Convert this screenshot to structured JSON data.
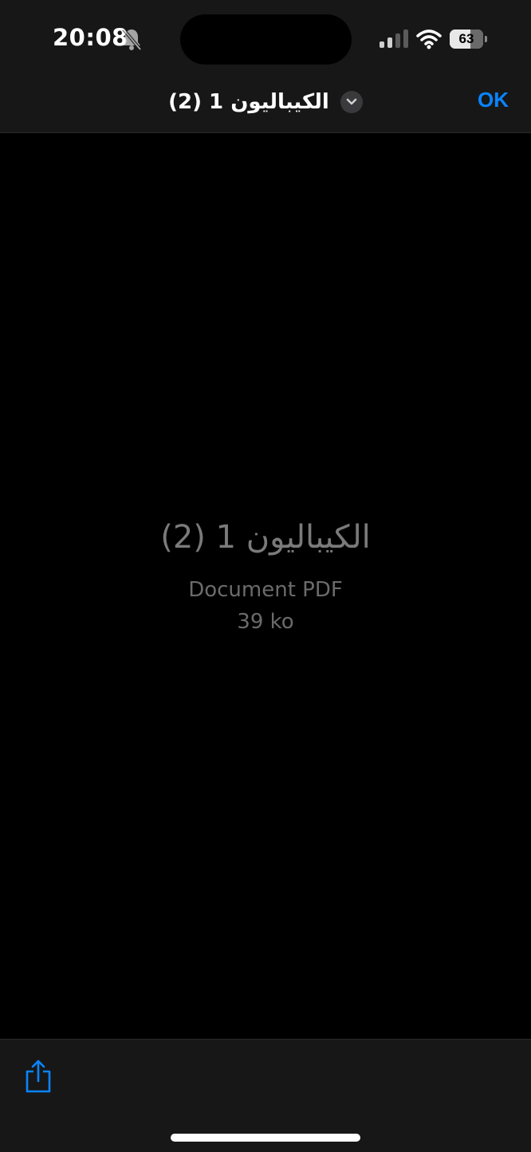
{
  "status_bar": {
    "time": "20:08",
    "battery_level": "63",
    "battery_fraction": 0.63
  },
  "nav": {
    "title": "الكيباليون 1 (2)",
    "done_label": "OK"
  },
  "file": {
    "name": "الكيباليون 1 (2)",
    "type": "Document PDF",
    "size": "39 ko"
  },
  "icons": {
    "bell": "bell-slash-icon",
    "signal": "cellular-signal-icon",
    "wifi": "wifi-icon",
    "battery": "battery-icon",
    "chevron": "chevron-down-icon",
    "share": "share-icon"
  },
  "colors": {
    "accent": "#0a84ff",
    "bar_background": "#171717",
    "content_background": "#000000",
    "secondary_text": "#6b6b6b"
  }
}
